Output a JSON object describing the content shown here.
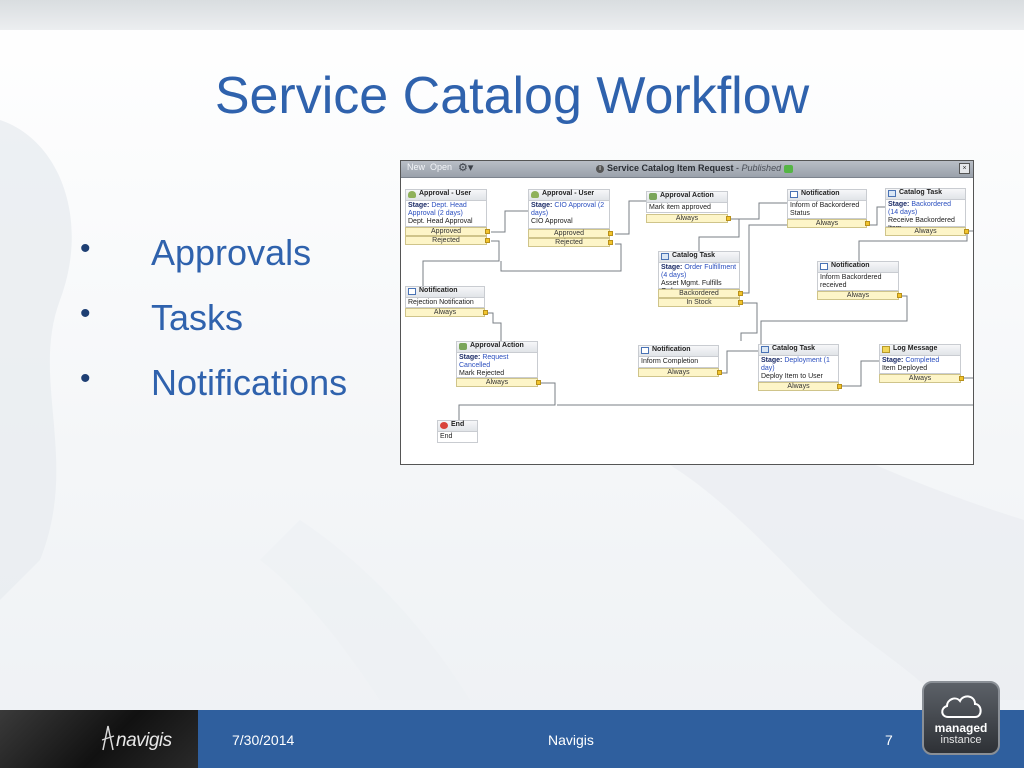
{
  "slide": {
    "title": "Service Catalog Workflow",
    "bullets": [
      "Approvals",
      "Tasks",
      "Notifications"
    ],
    "bullet_glyph": "•"
  },
  "workflow": {
    "toolbar": {
      "new_label": "New",
      "open_label": "Open",
      "gear": "⚙▾"
    },
    "title": "Service Catalog Item Request",
    "separator": " - ",
    "status": "Published",
    "nodes": {
      "approval_user_1": {
        "type": "Approval - User",
        "stage_label": "Stage:",
        "stage": "Dept. Head Approval (2 days)",
        "desc": "Dept. Head Approval",
        "conds": [
          "Approved",
          "Rejected"
        ]
      },
      "approval_user_2": {
        "type": "Approval - User",
        "stage_label": "Stage:",
        "stage": "CIO Approval (2 days)",
        "desc": "CIO Approval",
        "conds": [
          "Approved",
          "Rejected"
        ]
      },
      "approval_action_1": {
        "type": "Approval Action",
        "desc": "Mark item approved",
        "conds": [
          "Always"
        ]
      },
      "notification_1": {
        "type": "Notification",
        "desc": "Inform of Backordered Status",
        "conds": [
          "Always"
        ]
      },
      "catalog_task_1": {
        "type": "Catalog Task",
        "stage_label": "Stage:",
        "stage": "Backordered (14 days)",
        "desc": "Receive Backordered Item",
        "conds": [
          "Always"
        ]
      },
      "catalog_task_2": {
        "type": "Catalog Task",
        "stage_label": "Stage:",
        "stage": "Order Fulfillment (4 days)",
        "desc": "Asset Mgmt. Fulfills Order",
        "conds": [
          "Backordered",
          "In Stock"
        ]
      },
      "notification_2": {
        "type": "Notification",
        "desc": "Inform Backordered received",
        "conds": [
          "Always"
        ]
      },
      "notification_3": {
        "type": "Notification",
        "desc": "Rejection Notification",
        "conds": [
          "Always"
        ]
      },
      "approval_action_2": {
        "type": "Approval Action",
        "stage_label": "Stage:",
        "stage": "Request Cancelled",
        "desc": "Mark Rejected",
        "conds": [
          "Always"
        ]
      },
      "notification_4": {
        "type": "Notification",
        "desc": "Inform Completion",
        "conds": [
          "Always"
        ]
      },
      "catalog_task_3": {
        "type": "Catalog Task",
        "stage_label": "Stage:",
        "stage": "Deployment (1 day)",
        "desc": "Deploy Item to User",
        "conds": [
          "Always"
        ]
      },
      "log_message": {
        "type": "Log Message",
        "stage_label": "Stage:",
        "stage": "Completed",
        "desc": "Item Deployed",
        "conds": [
          "Always"
        ]
      },
      "end": {
        "type": "End",
        "desc": "End"
      }
    }
  },
  "footer": {
    "logo_text": "navigis",
    "date": "7/30/2014",
    "center": "Navigis",
    "page": "7",
    "badge_line1": "managed",
    "badge_line2": "instance"
  },
  "colors": {
    "title": "#2f62ad",
    "footer": "#2f5f9e",
    "stage_text": "#2b4fbf",
    "condition_fill": "#fdf5c8"
  }
}
